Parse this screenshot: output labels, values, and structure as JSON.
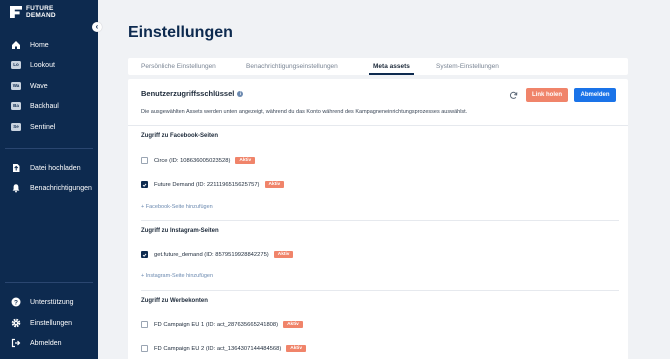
{
  "brand": {
    "line1": "FUTURE",
    "line2": "DEMAND"
  },
  "sidebar": {
    "collapse_icon": "‹",
    "main_items": [
      {
        "label": "Home",
        "icon": "home-icon"
      },
      {
        "label": "Lookout",
        "icon": "lookout-badge-icon",
        "badge": "Lo"
      },
      {
        "label": "Wave",
        "icon": "wave-badge-icon",
        "badge": "Wa"
      },
      {
        "label": "Backhaul",
        "icon": "backhaul-badge-icon",
        "badge": "Ba"
      },
      {
        "label": "Sentinel",
        "icon": "sentinel-badge-icon",
        "badge": "Se"
      }
    ],
    "secondary_items": [
      {
        "label": "Datei hochladen",
        "icon": "upload-file-icon"
      },
      {
        "label": "Benachrichtigungen",
        "icon": "bell-icon"
      }
    ],
    "bottom_items": [
      {
        "label": "Unterstützung",
        "icon": "help-icon"
      },
      {
        "label": "Einstellungen",
        "icon": "gear-icon"
      },
      {
        "label": "Abmelden",
        "icon": "logout-icon"
      }
    ]
  },
  "page": {
    "title": "Einstellungen"
  },
  "tabs": [
    {
      "label": "Persönliche Einstellungen",
      "active": false
    },
    {
      "label": "Benachrichtigungseinstellungen",
      "active": false
    },
    {
      "label": "Meta assets",
      "active": true
    },
    {
      "label": "System-Einstellungen",
      "active": false
    }
  ],
  "card": {
    "title": "Benutzerzugriffsschlüssel",
    "info_icon": "i",
    "link_button": "Link holen",
    "logout_button": "Abmelden",
    "description": "Die ausgewählten Assets werden unten angezeigt, während du das Konto während des Kampagneneinrichtungsprozesses auswählst."
  },
  "sections": {
    "facebook": {
      "title": "Zugriff zu Facebook-Seiten",
      "items": [
        {
          "label": "Circe (ID: 108636005023528)",
          "status": "Aktiv",
          "checked": false
        },
        {
          "label": "Future Demand (ID: 221119651562575​7)",
          "status": "Aktiv",
          "checked": true
        }
      ],
      "add_link": "+ Facebook-Seite hinzufügen"
    },
    "instagram": {
      "title": "Zugriff zu Instagram-Seiten",
      "items": [
        {
          "label": "get.future_demand (ID: 8579519928842275)",
          "status": "Aktiv",
          "checked": true
        }
      ],
      "add_link": "+ Instagram-Seite hinzufügen"
    },
    "ads": {
      "title": "Zugriff zu Werbekonten",
      "items": [
        {
          "label": "FD Campaign EU 1 (ID: act_287635665241808)",
          "status": "Aktiv",
          "checked": false
        },
        {
          "label": "FD Campaign EU 2 (ID: act_1364307144484568)",
          "status": "Aktiv",
          "checked": false
        }
      ]
    }
  },
  "colors": {
    "sidebar": "#0d2a4f",
    "accent_orange": "#f0846a",
    "accent_blue": "#1a73e8"
  }
}
